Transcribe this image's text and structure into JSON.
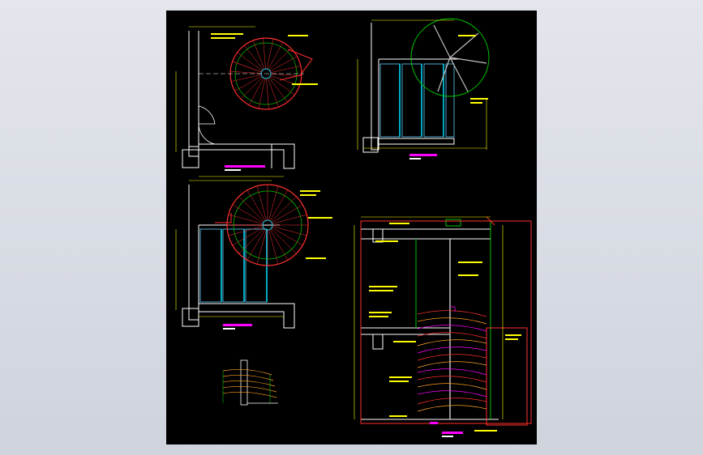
{
  "colors": {
    "background": "#d8dce4",
    "sheet": "#000000",
    "wall": "#ffffff",
    "dimension": "#ffff00",
    "stair_red": "#ff3030",
    "stair_green": "#00c000",
    "stair_cyan": "#00e0ff",
    "title_magenta": "#ff00ff",
    "glass_cyan": "#60d0ff",
    "annotation_orange": "#ffa020"
  },
  "icons": {
    "door_swing": "door-arc-icon",
    "section_marker": "section-flag-icon"
  }
}
